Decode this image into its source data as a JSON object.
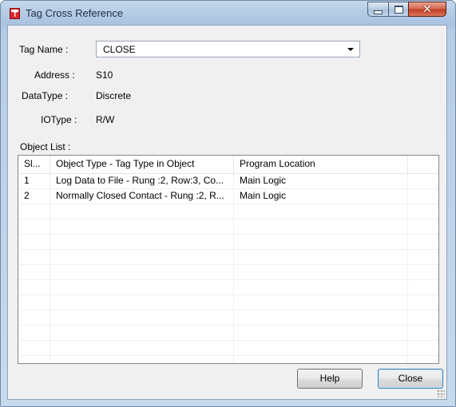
{
  "window": {
    "title": "Tag Cross Reference"
  },
  "form": {
    "tag_name_label": "Tag Name :",
    "tag_name_value": "CLOSE",
    "address_label": "Address :",
    "address_value": "S10",
    "datatype_label": "DataType :",
    "datatype_value": "Discrete",
    "iotype_label": "IOType :",
    "iotype_value": "R/W",
    "object_list_label": "Object List :"
  },
  "table": {
    "columns": [
      "Sl...",
      "Object Type - Tag Type in Object",
      "Program Location"
    ],
    "rows": [
      [
        "1",
        "Log Data to File - Rung :2, Row:3, Co...",
        "Main Logic"
      ],
      [
        "2",
        "Normally Closed Contact - Rung :2, R...",
        "Main Logic"
      ]
    ]
  },
  "buttons": {
    "help": "Help",
    "close": "Close"
  },
  "icons": {
    "app": "app-icon",
    "minimize": "minimize-icon",
    "maximize": "maximize-icon",
    "close": "close-icon",
    "dropdown": "chevron-down-icon",
    "grip": "resize-grip-icon"
  }
}
